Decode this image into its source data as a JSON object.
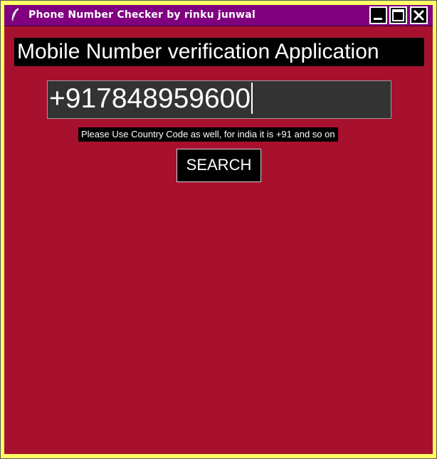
{
  "window": {
    "title": "Phone Number Checker by rinku junwal",
    "icon": "feather-icon",
    "controls": [
      "minimize-icon",
      "maximize-icon",
      "close-icon"
    ]
  },
  "app": {
    "heading": "Mobile Number verification Application",
    "phone_input": {
      "value": "+917848959600"
    },
    "hint": "Please Use Country Code as well, for india it is +91 and so on",
    "search_label": "SEARCH"
  },
  "colors": {
    "titlebar": "#800080",
    "background": "#a8112e",
    "frame": "#ffff66",
    "input_bg": "#333333",
    "label_bg": "#000000",
    "text": "#ffffff"
  }
}
